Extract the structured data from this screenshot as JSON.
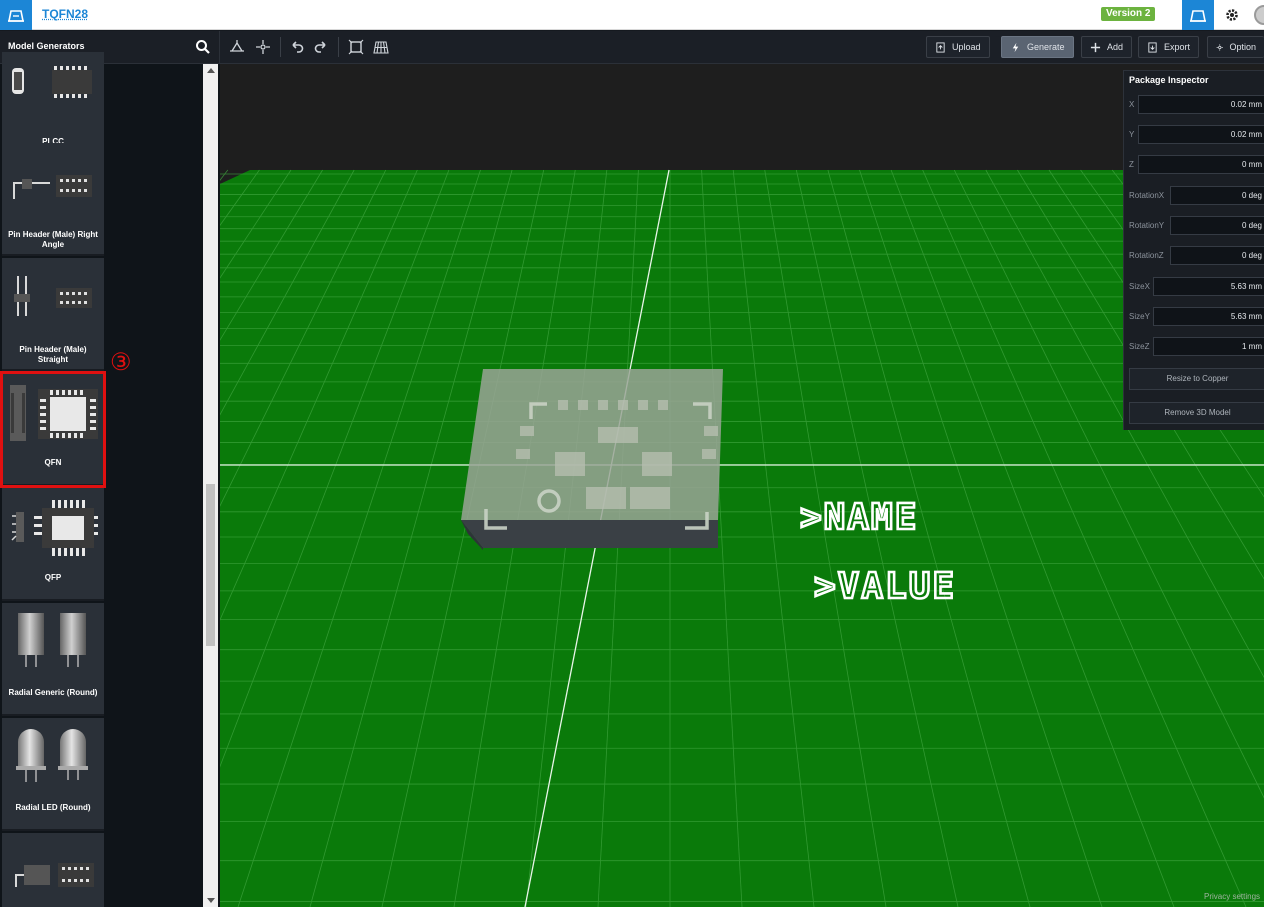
{
  "header": {
    "doc_title": "TQFN28",
    "version_badge": "Version 2"
  },
  "toolbar": {
    "panel_title": "Model Generators",
    "upload_label": "Upload",
    "generate_label": "Generate",
    "add_label": "Add",
    "export_label": "Export",
    "options_label": "Option"
  },
  "sidebar": {
    "step_marker": "③",
    "items": [
      {
        "label": "PLCC"
      },
      {
        "label": "Pin Header (Male) Right Angle"
      },
      {
        "label": "Pin Header (Male) Straight"
      },
      {
        "label": "QFN",
        "selected": true
      },
      {
        "label": "QFP"
      },
      {
        "label": "Radial Generic (Round)"
      },
      {
        "label": "Radial LED (Round)"
      },
      {
        "label": ""
      }
    ]
  },
  "viewport": {
    "name_text": ">NAME",
    "value_text": ">VALUE",
    "privacy_text": "Privacy settings"
  },
  "inspector": {
    "title": "Package Inspector",
    "fields": [
      {
        "label": "X",
        "value": "0.02 mm"
      },
      {
        "label": "Y",
        "value": "0.02 mm"
      },
      {
        "label": "Z",
        "value": "0 mm"
      },
      {
        "label": "RotationX",
        "value": "0 deg"
      },
      {
        "label": "RotationY",
        "value": "0 deg"
      },
      {
        "label": "RotationZ",
        "value": "0 deg"
      },
      {
        "label": "SizeX",
        "value": "5.63 mm"
      },
      {
        "label": "SizeY",
        "value": "5.63 mm"
      },
      {
        "label": "SizeZ",
        "value": "1 mm"
      }
    ],
    "resize_label": "Resize to Copper",
    "remove_label": "Remove 3D Model"
  },
  "colors": {
    "accent": "#1c86d6",
    "version_green": "#6cb33f",
    "pcb_green": "#0a7a0a",
    "selection_red": "#e01010"
  }
}
